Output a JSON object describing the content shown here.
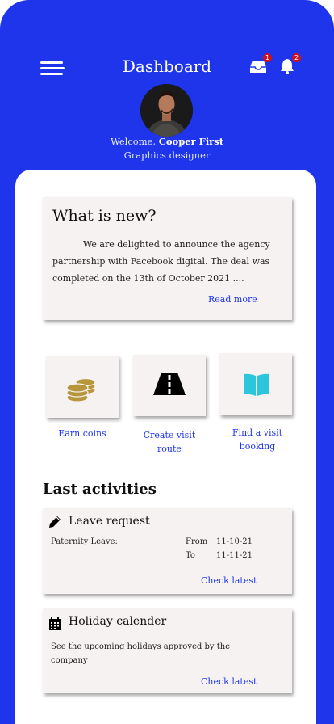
{
  "header": {
    "title": "Dashboard",
    "inbox_badge": "1",
    "notification_badge": "2"
  },
  "profile": {
    "welcome_prefix": "Welcome,",
    "name": "Cooper First",
    "role": "Graphics designer"
  },
  "news": {
    "title": "What is new?",
    "body": "We are delighted to announce the agency partnership with Facebook digital. The deal was completed on the 13th of October 2021 ....",
    "read_more": "Read more"
  },
  "actions": [
    {
      "label": "Earn coins",
      "icon": "coins-icon"
    },
    {
      "label": "Create visit route",
      "icon": "road-icon"
    },
    {
      "label": "Find a visit booking",
      "icon": "open-book-icon"
    }
  ],
  "activities": {
    "title": "Last activities",
    "leave": {
      "title": "Leave request",
      "icon": "pencil-icon",
      "type": "Paternity Leave:",
      "from_label": "From",
      "from_value": "11-10-21",
      "to_label": "To",
      "to_value": "11-11-21",
      "link": "Check latest"
    },
    "holiday": {
      "title": "Holiday calender",
      "icon": "calendar-icon",
      "description": "See the upcoming holidays approved by the company",
      "link": "Check latest"
    }
  },
  "colors": {
    "brand": "#1f35ec",
    "card": "#f6f2f2",
    "badge": "#d0101a"
  }
}
